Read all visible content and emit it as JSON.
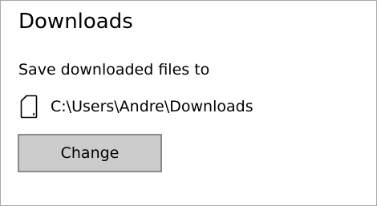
{
  "section": {
    "title": "Downloads"
  },
  "save_location": {
    "label": "Save downloaded files to",
    "icon": "sd-card-icon",
    "path": "C:\\Users\\Andre\\Downloads"
  },
  "change_button": {
    "label": "Change"
  },
  "colors": {
    "button_background": "#cccccc",
    "button_border": "#8a8a8a",
    "panel_border": "#a8a8a8",
    "text": "#000000"
  }
}
